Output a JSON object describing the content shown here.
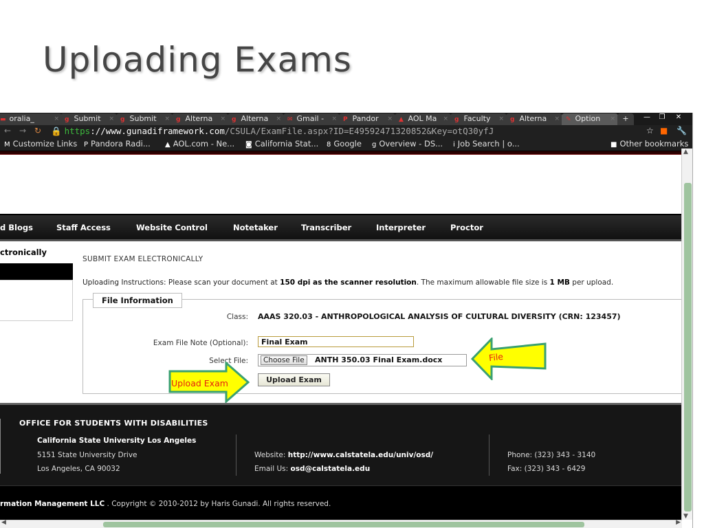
{
  "slide": {
    "title": "Uploading Exams"
  },
  "browser": {
    "tabs": [
      "oralia_",
      "Submit",
      "Submit",
      "Alterna",
      "Alterna",
      "Gmail -",
      "Pandor",
      "AOL Ma",
      "Faculty",
      "Alterna",
      "Option"
    ],
    "url_https": "https",
    "url_host": "://www.gunadiframework.com",
    "url_path": "/CSULA/ExamFile.aspx?ID=E49592471320852&Key=otQ30yfJ",
    "bookmarks": [
      "Customize Links",
      "Pandora Radi...",
      "AOL.com - Ne...",
      "California Stat...",
      "Google",
      "Overview - DS...",
      "Job Search | o..."
    ],
    "other_bookmarks": "Other bookmarks"
  },
  "nav": {
    "items": [
      "d Blogs",
      "Staff Access",
      "Website Control",
      "Notetaker",
      "Transcriber",
      "Interpreter",
      "Proctor"
    ]
  },
  "sidebar": {
    "title": "ctronically"
  },
  "content": {
    "heading": "SUBMIT EXAM ELECTRONICALLY",
    "instructions_prefix": "Uploading Instructions: Please scan your document at ",
    "instructions_dpi": "150 dpi as the scanner resolution",
    "instructions_mid": ". The maximum allowable file size is ",
    "instructions_size": "1 MB",
    "instructions_suffix": " per upload.",
    "legend": "File Information",
    "class_label": "Class:",
    "class_value": "AAAS 320.03 - ANTHROPOLOGICAL ANALYSIS OF CULTURAL DIVERSITY (CRN: 123457)",
    "note_label": "Exam File Note (Optional):",
    "note_value": "Final Exam",
    "file_label": "Select File:",
    "choose_file": "Choose File",
    "file_name": "ANTH 350.03 Final Exam.docx",
    "upload_button": "Upload Exam"
  },
  "callouts": {
    "file": "File",
    "upload": "Upload Exam",
    "arrow_fill": "#ffff00",
    "arrow_stroke": "#3aa070"
  },
  "footer": {
    "title": "OFFICE FOR STUDENTS WITH DISABILITIES",
    "org": "California State University Los Angeles",
    "address1": "5151 State University Drive",
    "address2": "Los Angeles, CA 90032",
    "website_label": "Website: ",
    "website": "http://www.calstatela.edu/univ/osd/",
    "email_label": "Email Us: ",
    "email": "osd@calstatela.edu",
    "phone": "Phone: (323) 343 - 3140",
    "fax": "Fax: (323) 343 - 6429",
    "copyright_bold": "rmation Management LLC",
    "copyright_rest": " . Copyright © 2010-2012 by Haris Gunadi. All rights reserved."
  }
}
